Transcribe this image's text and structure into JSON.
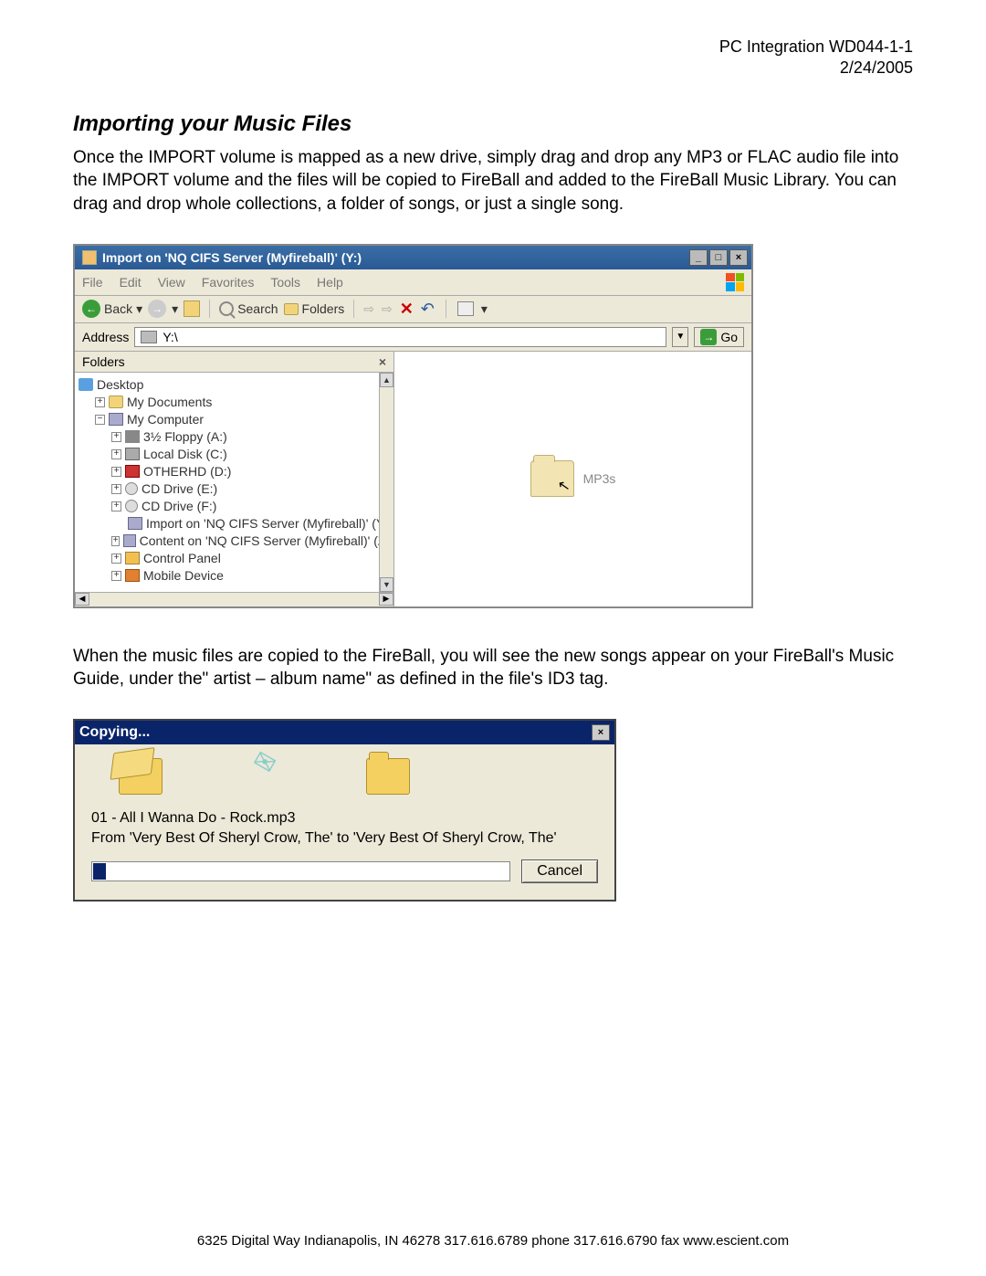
{
  "header": {
    "doc_id": "PC Integration WD044-1-1",
    "date": "2/24/2005"
  },
  "section_title": "Importing your Music Files",
  "intro": "Once the IMPORT volume is mapped as a new drive, simply drag and drop any MP3 or FLAC audio file into the IMPORT volume and the files will be copied to FireBall and added to the FireBall Music Library. You can drag and drop whole collections, a folder of songs, or just a single song.",
  "explorer": {
    "title": "Import on 'NQ CIFS Server (Myfireball)' (Y:)",
    "menu": [
      "File",
      "Edit",
      "View",
      "Favorites",
      "Tools",
      "Help"
    ],
    "toolbar": {
      "back": "Back",
      "search": "Search",
      "folders": "Folders"
    },
    "address_label": "Address",
    "address_value": "Y:\\",
    "go": "Go",
    "folders_label": "Folders",
    "tree": {
      "desktop": "Desktop",
      "mydocs": "My Documents",
      "mycomp": "My Computer",
      "floppy": "3½ Floppy (A:)",
      "localdisk": "Local Disk (C:)",
      "otherhd": "OTHERHD (D:)",
      "cde": "CD Drive (E:)",
      "cdf": "CD Drive (F:)",
      "import": "Import on 'NQ CIFS Server (Myfireball)' (Y:)",
      "content": "Content on 'NQ CIFS Server (Myfireball)' (Z:)",
      "cpanel": "Control Panel",
      "mobile": "Mobile Device"
    },
    "content_label": "MP3s"
  },
  "midtext": "When the music files are copied to the FireBall, you will see the new songs appear on your FireBall's Music Guide, under the\" artist – album name\" as defined in the file's ID3 tag.",
  "copy": {
    "title": "Copying...",
    "file": "01 - All I Wanna Do - Rock.mp3",
    "from": "From 'Very Best Of Sheryl Crow, The' to 'Very Best Of Sheryl Crow, The'",
    "cancel": "Cancel"
  },
  "footer": "6325 Digital Way   Indianapolis, IN 46278   317.616.6789 phone   317.616.6790 fax   www.escient.com"
}
